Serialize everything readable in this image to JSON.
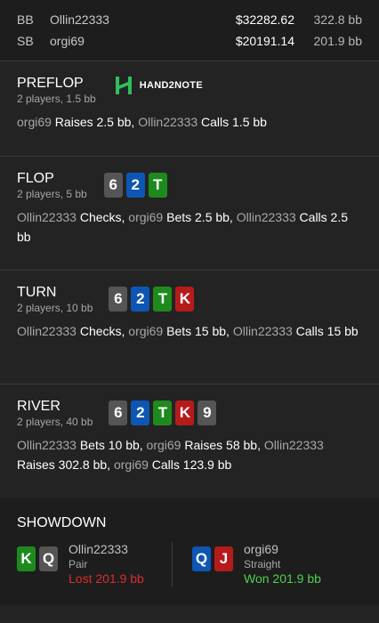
{
  "players": [
    {
      "pos": "BB",
      "name": "Ollin22333",
      "stack": "$32282.62",
      "bb": "322.8 bb"
    },
    {
      "pos": "SB",
      "name": "orgi69",
      "stack": "$20191.14",
      "bb": "201.9 bb"
    }
  ],
  "logo": {
    "text": "HAND2NOTE"
  },
  "preflop": {
    "title": "PREFLOP",
    "sub": "2 players, 1.5 bb",
    "actions": [
      {
        "who": "orgi69",
        "act": " Raises 2.5 bb, "
      },
      {
        "who": "Ollin22333",
        "act": " Calls 1.5 bb"
      }
    ]
  },
  "flop": {
    "title": "FLOP",
    "sub": "2 players, 5 bb",
    "cards": [
      {
        "rank": "6",
        "suit": "spade"
      },
      {
        "rank": "2",
        "suit": "diamond"
      },
      {
        "rank": "T",
        "suit": "club"
      }
    ],
    "actions": [
      {
        "who": "Ollin22333",
        "act": " Checks, "
      },
      {
        "who": "orgi69",
        "act": " Bets 2.5 bb, "
      },
      {
        "who": "Ollin22333",
        "act": " Calls 2.5 bb"
      }
    ]
  },
  "turn": {
    "title": "TURN",
    "sub": "2 players, 10 bb",
    "cards": [
      {
        "rank": "6",
        "suit": "spade"
      },
      {
        "rank": "2",
        "suit": "diamond"
      },
      {
        "rank": "T",
        "suit": "club"
      },
      {
        "rank": "K",
        "suit": "heart"
      }
    ],
    "actions": [
      {
        "who": "Ollin22333",
        "act": " Checks, "
      },
      {
        "who": "orgi69",
        "act": " Bets 15 bb, "
      },
      {
        "who": "Ollin22333",
        "act": " Calls 15 bb"
      }
    ]
  },
  "river": {
    "title": "RIVER",
    "sub": "2 players, 40 bb",
    "cards": [
      {
        "rank": "6",
        "suit": "spade"
      },
      {
        "rank": "2",
        "suit": "diamond"
      },
      {
        "rank": "T",
        "suit": "club"
      },
      {
        "rank": "K",
        "suit": "heart"
      },
      {
        "rank": "9",
        "suit": "spade"
      }
    ],
    "actions": [
      {
        "who": "Ollin22333",
        "act": " Bets 10 bb, "
      },
      {
        "who": "orgi69",
        "act": " Raises 58 bb, "
      },
      {
        "who": "Ollin22333",
        "act": " Raises 302.8 bb, "
      },
      {
        "who": "orgi69",
        "act": " Calls 123.9 bb"
      }
    ]
  },
  "showdown": {
    "title": "SHOWDOWN",
    "players": [
      {
        "name": "Ollin22333",
        "hand": "Pair",
        "result": "Lost 201.9 bb",
        "outcome": "lost",
        "cards": [
          {
            "rank": "K",
            "suit": "club"
          },
          {
            "rank": "Q",
            "suit": "spade"
          }
        ]
      },
      {
        "name": "orgi69",
        "hand": "Straight",
        "result": "Won 201.9 bb",
        "outcome": "won",
        "cards": [
          {
            "rank": "Q",
            "suit": "diamond"
          },
          {
            "rank": "J",
            "suit": "heart"
          }
        ]
      }
    ]
  },
  "colors": {
    "spade": "#555555",
    "diamond": "#0e56b4",
    "club": "#1e8a1e",
    "heart": "#b51b1b",
    "lost": "#d92e2e",
    "won": "#4fcf4f"
  }
}
